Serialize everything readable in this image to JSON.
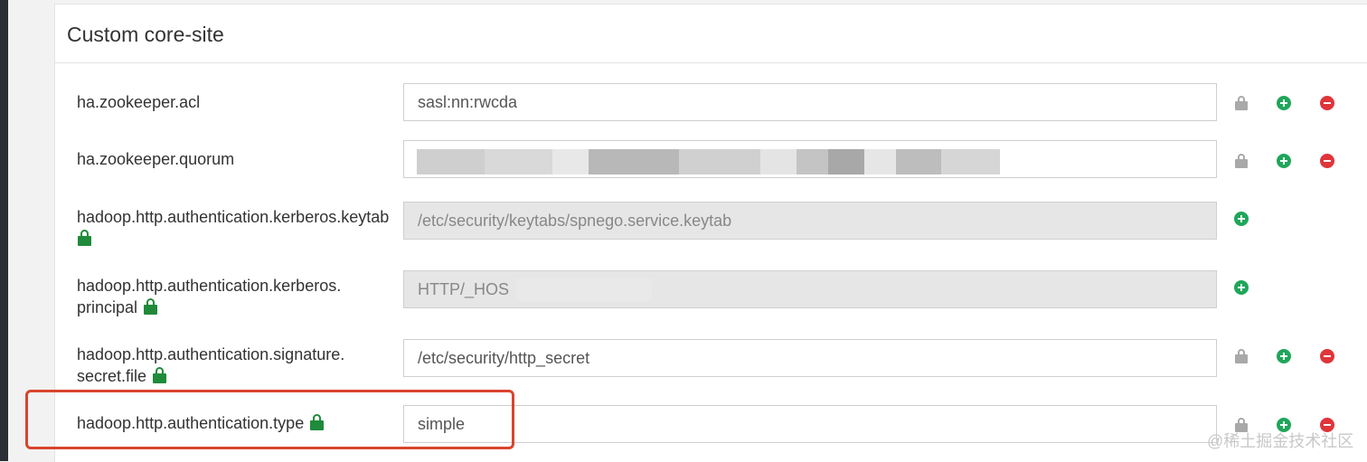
{
  "section": {
    "title": "Custom core-site"
  },
  "rows": [
    {
      "label_lines": [
        "ha.zookeeper.acl"
      ],
      "value": "sasl:nn:rwcda",
      "locked": false,
      "disabled": false
    },
    {
      "label_lines": [
        "ha.zookeeper.quorum"
      ],
      "value": "",
      "locked": false,
      "disabled": false
    },
    {
      "label_lines": [
        "hadoop.http.authentication.kerberos.keytab"
      ],
      "value": "/etc/security/keytabs/spnego.service.keytab",
      "locked": true,
      "disabled": true
    },
    {
      "label_lines": [
        "hadoop.http.authentication.kerberos.",
        "principal"
      ],
      "value": "HTTP/_HOS",
      "locked": true,
      "disabled": true
    },
    {
      "label_lines": [
        "hadoop.http.authentication.signature.",
        "secret.file"
      ],
      "value": "/etc/security/http_secret",
      "locked": true,
      "disabled": false
    },
    {
      "label_lines": [
        "hadoop.http.authentication.type"
      ],
      "value": "simple",
      "locked": true,
      "disabled": false
    }
  ],
  "watermark": "@稀土掘金技术社区",
  "colors": {
    "add_button": "#1fa65a",
    "remove_button": "#e0353a",
    "lock_green": "#1f8b3a",
    "highlight": "#d9442e"
  },
  "icons": {
    "add": "plus-circle-icon",
    "remove": "minus-circle-icon",
    "lock_grey": "lock-icon",
    "lock_green": "lock-icon"
  }
}
